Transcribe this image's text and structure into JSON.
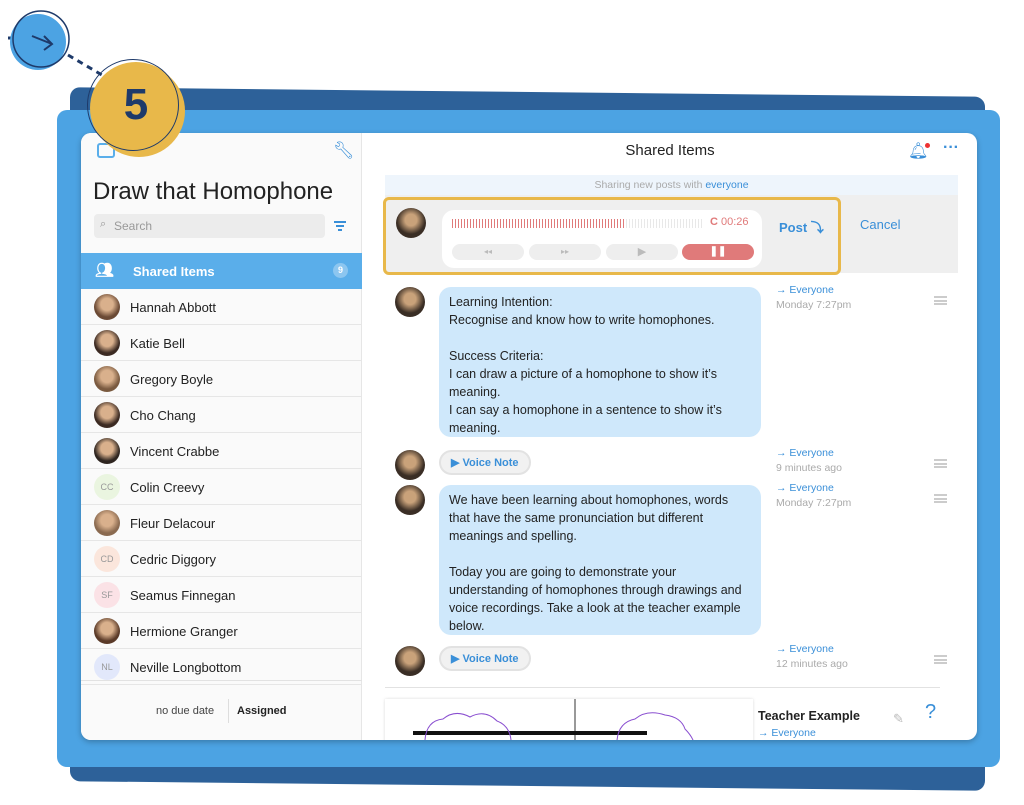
{
  "step_number": "5",
  "sidebar": {
    "title": "Draw that Homophone",
    "search_placeholder": "Search",
    "shared_label": "Shared Items",
    "shared_count": "9",
    "students": [
      {
        "name": "Hannah Abbott",
        "initials": "",
        "color": "#6b4a35"
      },
      {
        "name": "Katie Bell",
        "initials": "",
        "color": "#3b2a22"
      },
      {
        "name": "Gregory Boyle",
        "initials": "",
        "color": "#7a5a40"
      },
      {
        "name": "Cho Chang",
        "initials": "",
        "color": "#3b2a22"
      },
      {
        "name": "Vincent Crabbe",
        "initials": "",
        "color": "#2e2520"
      },
      {
        "name": "Colin Creevy",
        "initials": "CC",
        "color": "#eaf5e0"
      },
      {
        "name": "Fleur Delacour",
        "initials": "",
        "color": "#8a6a50"
      },
      {
        "name": "Cedric Diggory",
        "initials": "CD",
        "color": "#fbe6dc"
      },
      {
        "name": "Seamus Finnegan",
        "initials": "SF",
        "color": "#fbe2e6"
      },
      {
        "name": "Hermione Granger",
        "initials": "",
        "color": "#5a3a28"
      },
      {
        "name": "Neville Longbottom",
        "initials": "NL",
        "color": "#e2e8fb"
      }
    ],
    "due": "no due date",
    "status": "Assigned"
  },
  "main": {
    "title": "Shared Items",
    "sharing_prefix": "Sharing new posts with",
    "sharing_target": "everyone",
    "recorder": {
      "time": "00:26",
      "post": "Post",
      "cancel": "Cancel",
      "progress": 0.69
    },
    "posts": [
      {
        "type": "text",
        "text": "Learning Intention:\nRecognise and know how to write homophones.\n\nSuccess Criteria:\nI can draw a picture of a homophone to show it’s meaning.\nI can say a homophone in a sentence to show it’s meaning.",
        "to": "Everyone",
        "time": "Monday 7:27pm"
      },
      {
        "type": "voice",
        "text": "▶ Voice Note",
        "to": "Everyone",
        "time": "9 minutes ago"
      },
      {
        "type": "text",
        "text": "We have been learning about homophones, words that have the same pronunciation but different meanings and spelling.\n\nToday you are going to demonstrate your understanding of homophones through drawings and voice recordings. Take a look at the teacher example below.",
        "to": "Everyone",
        "time": "Monday 7:27pm"
      },
      {
        "type": "voice",
        "text": "▶ Voice Note",
        "to": "Everyone",
        "time": "12 minutes ago"
      }
    ],
    "example": {
      "title": "Teacher Example",
      "to": "Everyone"
    }
  },
  "colors": {
    "accent": "#3a8fd8",
    "highlight": "#e8b84a",
    "record": "#e07a7a"
  }
}
